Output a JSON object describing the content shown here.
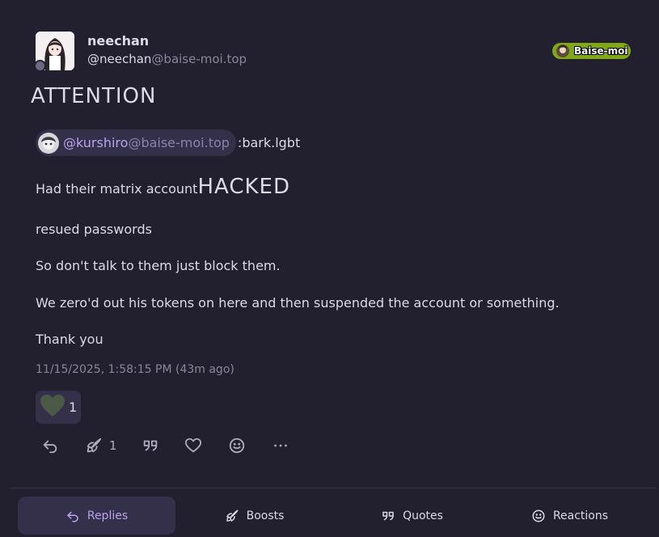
{
  "author": {
    "display_name": "neechan",
    "username": "@neechan",
    "host": "@baise-moi.top"
  },
  "instance": {
    "name": "Baise-moi",
    "color": "#7fa814"
  },
  "note": {
    "heading": "ATTENTION",
    "mention": {
      "user": "@kurshiro",
      "host": "@baise-moi.top"
    },
    "emoji_code": ":bark.lgbt",
    "hacked_prefix": "Had their matrix account",
    "hacked_word": "HACKED",
    "paragraphs": [
      "resued passwords",
      "So don't talk to them just block them.",
      "We zero'd out his tokens on here and then suspended the account or something.",
      "Thank you"
    ],
    "timestamp": "11/15/2025, 1:58:15 PM (43m ago)"
  },
  "reaction": {
    "icon": "heart-icon",
    "count": "1"
  },
  "actions": {
    "reply": {
      "icon": "reply-icon"
    },
    "boost": {
      "icon": "rocket-icon",
      "count": "1"
    },
    "quote": {
      "icon": "quote-icon"
    },
    "like": {
      "icon": "heart-outline-icon"
    },
    "react": {
      "icon": "smile-icon"
    },
    "more": {
      "icon": "more-icon"
    }
  },
  "tabs": [
    {
      "label": "Replies",
      "icon": "reply-icon",
      "active": true
    },
    {
      "label": "Boosts",
      "icon": "rocket-icon"
    },
    {
      "label": "Quotes",
      "icon": "quote-icon"
    },
    {
      "label": "Reactions",
      "icon": "smile-icon"
    }
  ],
  "colors": {
    "background": "#221f2e",
    "accent": "#b9a4ef",
    "chip": "#35304a"
  }
}
